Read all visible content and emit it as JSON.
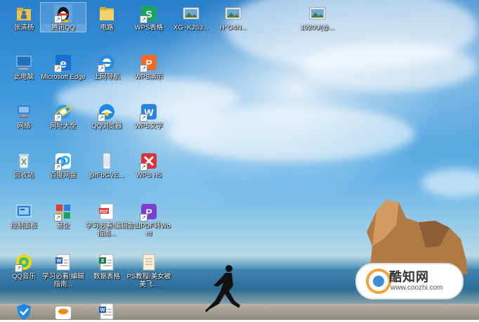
{
  "desktop": {
    "icons": [
      {
        "label": "张清杨",
        "icon": "user-folder-icon"
      },
      {
        "label": "腾讯QQ",
        "icon": "qq-penguin-icon"
      },
      {
        "label": "电路",
        "icon": "folder-icon"
      },
      {
        "label": "WPS表格",
        "icon": "wps-sheet-icon"
      },
      {
        "label": "XG~KJS3...",
        "icon": "image-file-icon"
      },
      {
        "label": "H^O4N...",
        "icon": "image-file-icon"
      },
      {
        "label": "1920U(@...",
        "icon": "image-file-icon"
      },
      {
        "label": "此电脑",
        "icon": "computer-icon"
      },
      {
        "label": "Microsoft Edge",
        "icon": "edge-icon"
      },
      {
        "label": "上网导航",
        "icon": "browser-nav-icon"
      },
      {
        "label": "WPS演示",
        "icon": "wps-presentation-icon"
      },
      {
        "label": "网络",
        "icon": "network-icon"
      },
      {
        "label": "网址大全",
        "icon": "ie-browser-icon"
      },
      {
        "label": "QQ浏览器",
        "icon": "qq-browser-icon"
      },
      {
        "label": "WPS文字",
        "icon": "wps-writer-icon"
      },
      {
        "label": "回收站",
        "icon": "recycle-bin-icon"
      },
      {
        "label": "百度网盘",
        "icon": "baidu-netdisk-icon"
      },
      {
        "label": "j9rFbGVE...",
        "icon": "phone-image-icon"
      },
      {
        "label": "WPS H5",
        "icon": "wps-h5-icon"
      },
      {
        "label": "控制面板",
        "icon": "control-panel-icon"
      },
      {
        "label": "易企",
        "icon": "app-grid-icon"
      },
      {
        "label": "学习必看!编辑指南...",
        "icon": "pdf-icon"
      },
      {
        "label": "金山PDF转Word",
        "icon": "pdf-convert-icon"
      },
      {
        "label": "QQ音乐",
        "icon": "qq-music-icon"
      },
      {
        "label": "学习必看!编辑指南...",
        "icon": "word-doc-icon"
      },
      {
        "label": "数据表格",
        "icon": "excel-icon"
      },
      {
        "label": "PS教程!美女被美飞...",
        "icon": "text-file-icon"
      },
      {
        "label": "",
        "icon": "shield-icon"
      },
      {
        "label": "",
        "icon": "orange-app-icon"
      },
      {
        "label": "",
        "icon": "word-doc-icon"
      }
    ],
    "selected_label": "腾讯QQ"
  },
  "watermark": {
    "name": "酷知网",
    "url": "www.coozhi.com"
  },
  "colors": {
    "wps_green": "#1aa260",
    "wps_orange": "#f06a2a",
    "wps_blue": "#2b82e0",
    "wps_red": "#d9343a",
    "sky": "#3f97da"
  }
}
